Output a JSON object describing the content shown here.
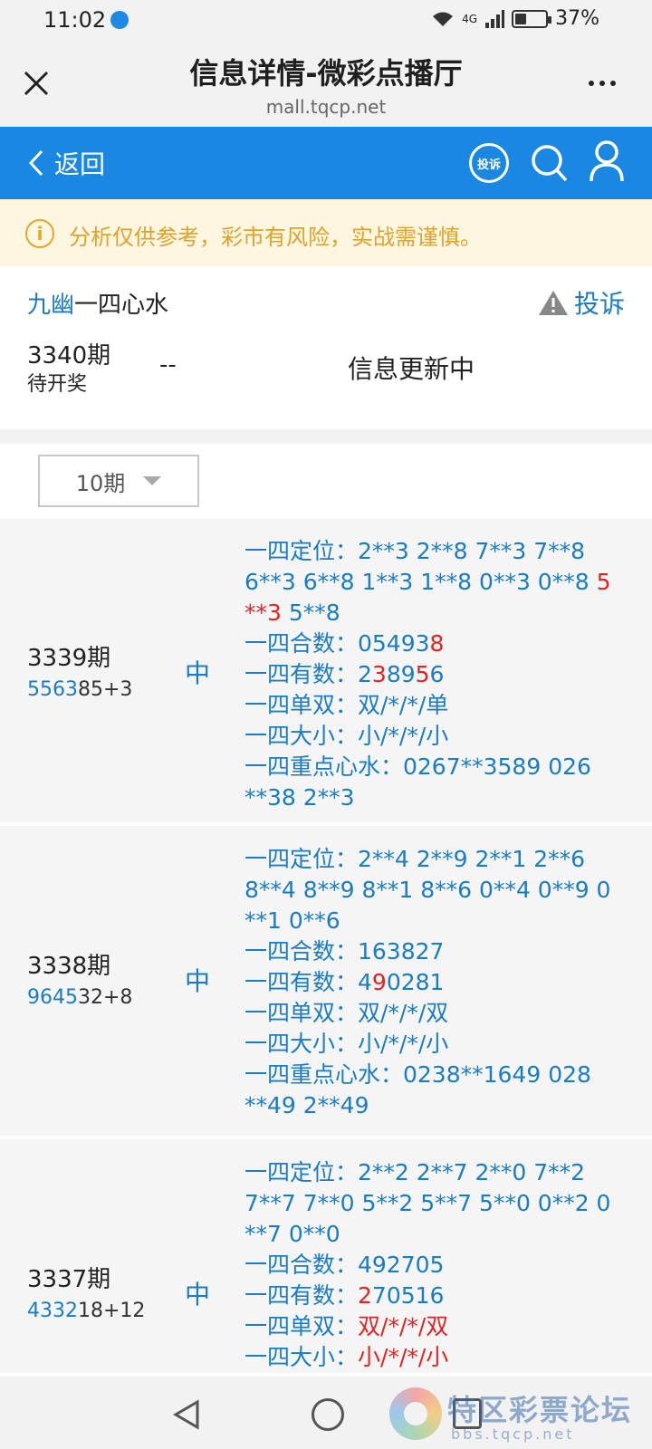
{
  "status_bar": {
    "time": "11:02",
    "network": "4G",
    "battery": "37%"
  },
  "browser": {
    "title": "信息详情-微彩点播厅",
    "url": "mall.tqcp.net"
  },
  "header": {
    "back_label": "返回",
    "complain_label": "投诉"
  },
  "notice": {
    "text": "分析仅供参考，彩市有风险，实战需谨慎。"
  },
  "info": {
    "author_highlight": "九幽",
    "author_rest": "一四心水",
    "report_label": "投诉",
    "period": "3340期",
    "status": "待开奖",
    "dash": "--",
    "update_text": "信息更新中"
  },
  "filter": {
    "selected": "10期"
  },
  "records": [
    {
      "period": "3339期",
      "nums_blue": "5563",
      "nums_rest": "85+3",
      "hit": "中",
      "lines": {
        "a1": "一四定位：2**3 2**8 7**3 7**8",
        "a2": "6**3 6**8 1**3 1**8 0**3 0**8 ",
        "a2r": "5",
        "a3r1": "**3",
        "a3": " 5**8",
        "b_pre": "一四合数：05493",
        "b_red": "8",
        "c_pre": "一四有数：2",
        "c_red1": "3",
        "c_mid": "89",
        "c_red2": "5",
        "c_post": "6",
        "d": "一四单双：双/*/*/单",
        "e": "一四大小：小/*/*/小",
        "f1": "一四重点心水：0267**3589 026",
        "f2": "**38 2**3"
      }
    },
    {
      "period": "3338期",
      "nums_blue": "9645",
      "nums_rest": "32+8",
      "hit": "中",
      "lines": {
        "a1": "一四定位：2**4 2**9 2**1 2**6",
        "a2": "8**4 8**9 8**1 8**6 0**4 0**9 0",
        "a3": "**1 0**6",
        "b": "一四合数：163827",
        "c_pre": "一四有数：4",
        "c_red": "9",
        "c_post": "0281",
        "d": "一四单双：双/*/*/双",
        "e": "一四大小：小/*/*/小",
        "f1": "一四重点心水：0238**1649 028",
        "f2": "**49 2**49"
      }
    },
    {
      "period": "3337期",
      "nums_blue": "4332",
      "nums_rest": "18+12",
      "hit": "中",
      "lines": {
        "a1": "一四定位：2**2 2**7 2**0 7**2",
        "a2": "7**7 7**0 5**2 5**7 5**0 0**2 0",
        "a3": "**7 0**0",
        "b": "一四合数：492705",
        "c_pre": "一四有数：",
        "c_red": "2",
        "c_post": "70516",
        "d_pre": "一四单双：",
        "d_red": "双/*/*/双",
        "e_pre": "一四大小：",
        "e_red": "小/*/*/小"
      }
    }
  ],
  "watermark": {
    "text": "特区彩票论坛",
    "url": "bbs.tqcp.net"
  }
}
